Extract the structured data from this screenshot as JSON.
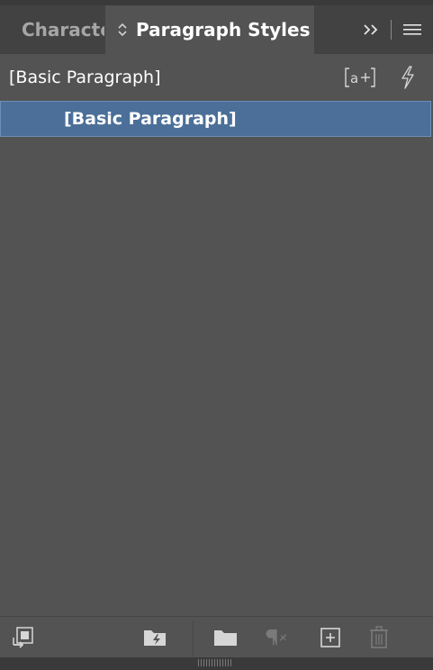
{
  "tabs": [
    {
      "label": "Characte",
      "active": false
    },
    {
      "label": "Paragraph Styles",
      "active": true
    }
  ],
  "tab_controls": {
    "expand_icon": "double-chevron-right-icon",
    "menu_icon": "hamburger-menu-icon"
  },
  "style_header": {
    "current_style": "[Basic Paragraph]",
    "icons": [
      "new-style-group-bracket-icon",
      "quick-apply-lightning-icon"
    ]
  },
  "style_list": {
    "items": [
      {
        "label": "[Basic Paragraph]",
        "selected": true
      }
    ]
  },
  "footer": {
    "icons": [
      "load-styles-icon",
      "clear-overrides-folder-lightning-icon",
      "create-group-folder-icon",
      "clear-paragraph-overrides-icon",
      "new-style-icon",
      "delete-style-icon"
    ]
  },
  "colors": {
    "panel_bg": "#535353",
    "tabbar_bg": "#424242",
    "selection_bg": "#4b6f98",
    "text": "#ffffff",
    "inactive_text": "#a6a6a6"
  }
}
